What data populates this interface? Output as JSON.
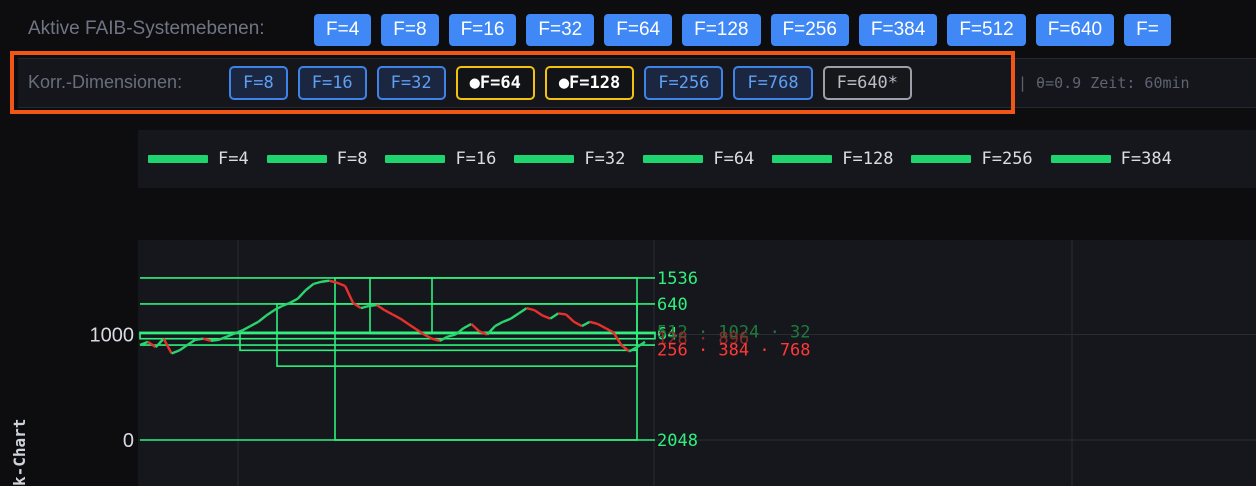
{
  "top_bar": {
    "label": "Aktive FAIB-Systemebenen:",
    "buttons": [
      "F=4",
      "F=8",
      "F=16",
      "F=32",
      "F=64",
      "F=128",
      "F=256",
      "F=384",
      "F=512",
      "F=640",
      "F="
    ]
  },
  "corr_bar": {
    "label": "Korr.-Dimensionen:",
    "buttons": [
      {
        "label": "F=8",
        "state": "normal"
      },
      {
        "label": "F=16",
        "state": "normal"
      },
      {
        "label": "F=32",
        "state": "normal"
      },
      {
        "label": "●F=64",
        "state": "active"
      },
      {
        "label": "●F=128",
        "state": "active"
      },
      {
        "label": "F=256",
        "state": "normal"
      },
      {
        "label": "F=768",
        "state": "normal"
      },
      {
        "label": "F=640*",
        "state": "custom"
      }
    ],
    "info": "| θ=0.9 Zeit: 60min"
  },
  "legend": {
    "items": [
      "F=4",
      "F=8",
      "F=16",
      "F=32",
      "F=64",
      "F=128",
      "F=256",
      "F=384"
    ]
  },
  "chart_data": {
    "type": "line",
    "ylabel": "k-Chart",
    "y_ticks": [
      0,
      1000
    ],
    "ylim": [
      -300,
      1650
    ],
    "grid": true,
    "price_series": {
      "y": [
        900,
        930,
        880,
        960,
        820,
        850,
        900,
        950,
        960,
        940,
        950,
        980,
        1010,
        1040,
        1080,
        1120,
        1180,
        1230,
        1270,
        1300,
        1340,
        1420,
        1480,
        1500,
        1510,
        1490,
        1460,
        1300,
        1250,
        1270,
        1280,
        1230,
        1190,
        1150,
        1100,
        1050,
        1000,
        960,
        940,
        980,
        1000,
        1060,
        1100,
        1030,
        1000,
        1080,
        1120,
        1150,
        1200,
        1250,
        1230,
        1180,
        1150,
        1200,
        1190,
        1120,
        1080,
        1120,
        1100,
        1060,
        1020,
        900,
        840,
        880,
        930
      ]
    },
    "level_labels": [
      {
        "text": "1536",
        "y": 1536,
        "color": "#2ef07d"
      },
      {
        "text": "640",
        "y": 1290,
        "color": "#2ef07d"
      },
      {
        "text": "64",
        "y": 1010,
        "color": "#2ef07d"
      },
      {
        "text": "512 · 1024 · 32",
        "y": 1030,
        "color": "#1f7a3c"
      },
      {
        "text": "128 · 896",
        "y": 965,
        "color": "#8a2b2b"
      },
      {
        "text": "256 · 384 · 768",
        "y": 860,
        "color": "#ff3838"
      },
      {
        "text": "2048",
        "y": 0,
        "color": "#2ef07d"
      }
    ],
    "colors": {
      "up": "#2ad46f",
      "down": "#e8302c",
      "level": "#2ef07d"
    }
  }
}
